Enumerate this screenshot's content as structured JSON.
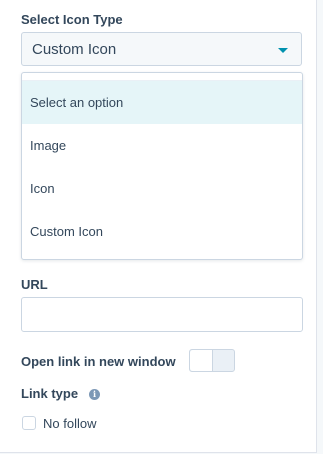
{
  "icon_type": {
    "label": "Select Icon Type",
    "selected": "Custom Icon",
    "options": [
      {
        "label": "Select an option",
        "highlighted": true
      },
      {
        "label": "Image",
        "highlighted": false
      },
      {
        "label": "Icon",
        "highlighted": false
      },
      {
        "label": "Custom Icon",
        "highlighted": false
      }
    ]
  },
  "url": {
    "label": "URL",
    "value": "",
    "placeholder": ""
  },
  "new_window": {
    "label": "Open link in new window",
    "on": false
  },
  "link_type": {
    "label": "Link type",
    "info_icon": "info-icon",
    "no_follow_label": "No follow",
    "no_follow_checked": false
  },
  "colors": {
    "text": "#33475b",
    "accent": "#0091ae",
    "border": "#cbd6e2",
    "highlight": "#e5f5f8"
  }
}
